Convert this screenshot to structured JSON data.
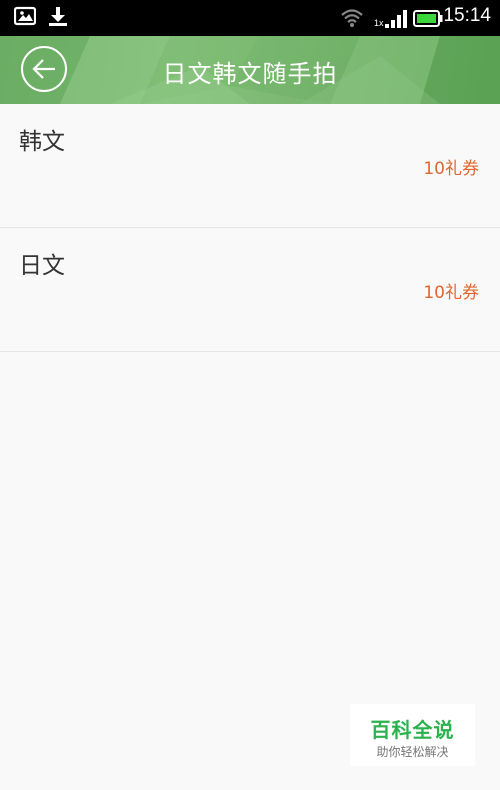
{
  "status_bar": {
    "time": "15:14",
    "network_label": "1x",
    "icons": [
      "image-icon",
      "download-icon",
      "wifi-icon",
      "signal-icon",
      "battery-icon"
    ]
  },
  "header": {
    "title": "日文韩文随手拍",
    "back_icon": "arrow-left-icon"
  },
  "list": {
    "items": [
      {
        "title": "韩文",
        "price": "10礼券"
      },
      {
        "title": "日文",
        "price": "10礼券"
      }
    ]
  },
  "watermark": {
    "title": "百科全说",
    "subtitle": "助你轻松解决"
  },
  "colors": {
    "header_green": "#7bb871",
    "price_orange": "#e2662e",
    "watermark_green": "#2bb24c",
    "battery_green": "#3cd63c"
  }
}
